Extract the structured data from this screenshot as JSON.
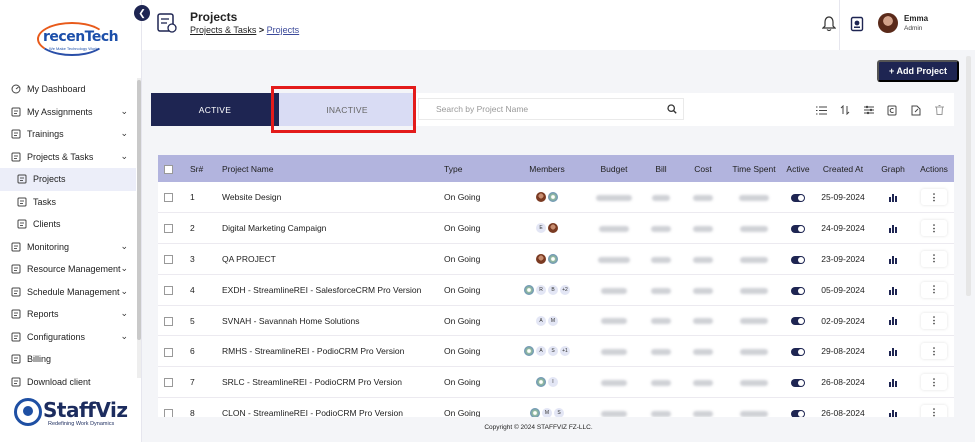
{
  "brand": {
    "logo_word": "recenTech",
    "logo_tag": "We Make Technology Work",
    "product_name": "StaffViz",
    "product_tag": "Redefining Work Dynamics"
  },
  "sidebar": {
    "items": [
      {
        "label": "My Dashboard",
        "icon": "dashboard-icon",
        "chevron": false
      },
      {
        "label": "My Assignments",
        "icon": "assignments-icon",
        "chevron": true
      },
      {
        "label": "Trainings",
        "icon": "training-icon",
        "chevron": true
      },
      {
        "label": "Projects & Tasks",
        "icon": "projects-tasks-icon",
        "chevron": true
      },
      {
        "label": "Projects",
        "icon": "projects-icon",
        "chevron": false,
        "sub": true,
        "active": true
      },
      {
        "label": "Tasks",
        "icon": "tasks-icon",
        "chevron": false,
        "sub": true
      },
      {
        "label": "Clients",
        "icon": "clients-icon",
        "chevron": false,
        "sub": true
      },
      {
        "label": "Monitoring",
        "icon": "monitoring-icon",
        "chevron": true
      },
      {
        "label": "Resource Management",
        "icon": "resource-icon",
        "chevron": true
      },
      {
        "label": "Schedule Management",
        "icon": "schedule-icon",
        "chevron": true
      },
      {
        "label": "Reports",
        "icon": "reports-icon",
        "chevron": true
      },
      {
        "label": "Configurations",
        "icon": "configurations-icon",
        "chevron": true
      },
      {
        "label": "Billing",
        "icon": "billing-icon",
        "chevron": false
      },
      {
        "label": "Download client",
        "icon": "download-icon",
        "chevron": false
      }
    ]
  },
  "header": {
    "title": "Projects",
    "breadcrumb_parent": "Projects & Tasks",
    "breadcrumb_sep": ">",
    "breadcrumb_current": "Projects",
    "user_name": "Emma",
    "user_role": "Admin"
  },
  "toolbar": {
    "add_label": "+ Add Project",
    "tab_active": "ACTIVE",
    "tab_inactive": "INACTIVE",
    "search_placeholder": "Search by Project Name"
  },
  "table": {
    "columns": [
      "Sr#",
      "Project Name",
      "Type",
      "Members",
      "Budget",
      "Bill",
      "Cost",
      "Time Spent",
      "Active",
      "Created At",
      "Graph",
      "Actions"
    ],
    "rows": [
      {
        "sr": "1",
        "name": "Website Design",
        "type": "On Going",
        "members": [
          "img",
          "wa"
        ],
        "created": "25-09-2024"
      },
      {
        "sr": "2",
        "name": "Digital Marketing Campaign",
        "type": "On Going",
        "members": [
          "E",
          "img"
        ],
        "created": "24-09-2024"
      },
      {
        "sr": "3",
        "name": "QA PROJECT",
        "type": "On Going",
        "members": [
          "img",
          "wa"
        ],
        "created": "23-09-2024"
      },
      {
        "sr": "4",
        "name": "EXDH - StreamlineREI - SalesforceCRM Pro Version",
        "type": "On Going",
        "members": [
          "wa",
          "R",
          "B",
          "+2"
        ],
        "created": "05-09-2024"
      },
      {
        "sr": "5",
        "name": "SVNAH - Savannah Home Solutions",
        "type": "On Going",
        "members": [
          "A",
          "M"
        ],
        "created": "02-09-2024"
      },
      {
        "sr": "6",
        "name": "RMHS - StreamlineREI - PodioCRM Pro Version",
        "type": "On Going",
        "members": [
          "wa",
          "A",
          "S",
          "+1"
        ],
        "created": "29-08-2024"
      },
      {
        "sr": "7",
        "name": "SRLC - StreamlineREI - PodioCRM Pro Version",
        "type": "On Going",
        "members": [
          "wa",
          "I"
        ],
        "created": "26-08-2024"
      },
      {
        "sr": "8",
        "name": "CLON - StreamlineREI - PodioCRM Pro Version",
        "type": "On Going",
        "members": [
          "wa",
          "M",
          "S"
        ],
        "created": "26-08-2024"
      }
    ]
  },
  "footer": {
    "copyright": "Copyright © 2024 STAFFVIZ FZ-LLC."
  },
  "colors": {
    "primary": "#1e2552",
    "inactive_tab": "#d9dcf4",
    "table_header": "#b2b4de",
    "highlight": "#e31b1b"
  }
}
